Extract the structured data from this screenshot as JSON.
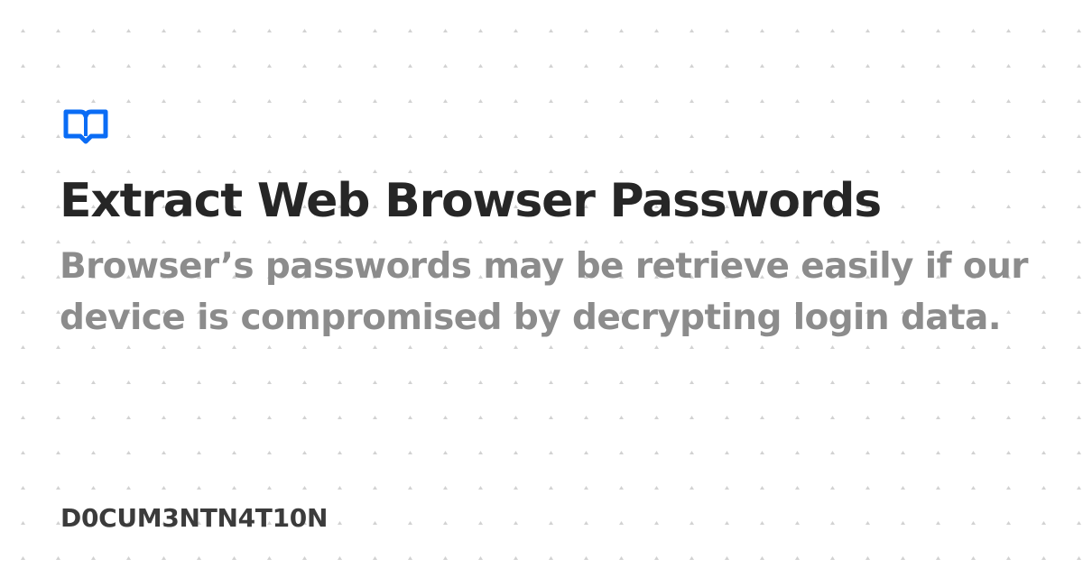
{
  "card": {
    "logo_icon": "book-icon",
    "accent_color": "#0a6cf5",
    "title": "Extract Web Browser Passwords",
    "description": "Browser’s passwords may be retrieve easily if our device is compromised by decrypting login data.",
    "site_name": "D0CUM3NTN4T10N"
  },
  "colors": {
    "background": "#ffffff",
    "dot_pattern": "#d2d2d2",
    "title": "#262626",
    "description": "#8c8c8c",
    "footer": "#3b3b3b"
  }
}
